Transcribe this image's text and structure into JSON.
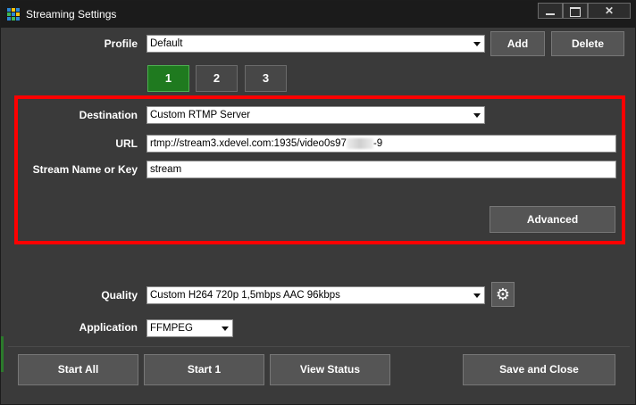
{
  "window": {
    "title": "Streaming Settings",
    "icon": "app-grid-icon"
  },
  "profile": {
    "label": "Profile",
    "value": "Default",
    "add_label": "Add",
    "delete_label": "Delete"
  },
  "tabs": [
    {
      "label": "1",
      "active": true
    },
    {
      "label": "2",
      "active": false
    },
    {
      "label": "3",
      "active": false
    }
  ],
  "destination": {
    "label": "Destination",
    "value": "Custom RTMP Server"
  },
  "url": {
    "label": "URL",
    "value_prefix": "rtmp://stream3.xdevel.com:1935/video0s97",
    "value_suffix": "-9"
  },
  "stream_key": {
    "label": "Stream Name or Key",
    "value": "stream"
  },
  "advanced_label": "Advanced",
  "quality": {
    "label": "Quality",
    "value": "Custom H264 720p 1,5mbps AAC 96kbps",
    "settings_icon": "gear-icon"
  },
  "application": {
    "label": "Application",
    "value": "FFMPEG"
  },
  "footer": {
    "start_all": "Start All",
    "start_1": "Start 1",
    "view_status": "View Status",
    "save_close": "Save and Close"
  },
  "colors": {
    "highlight_frame": "#ff0000",
    "active_tab": "#1f7a1f",
    "window_bg": "#3a3a3a",
    "titlebar_bg": "#1b1b1b"
  }
}
